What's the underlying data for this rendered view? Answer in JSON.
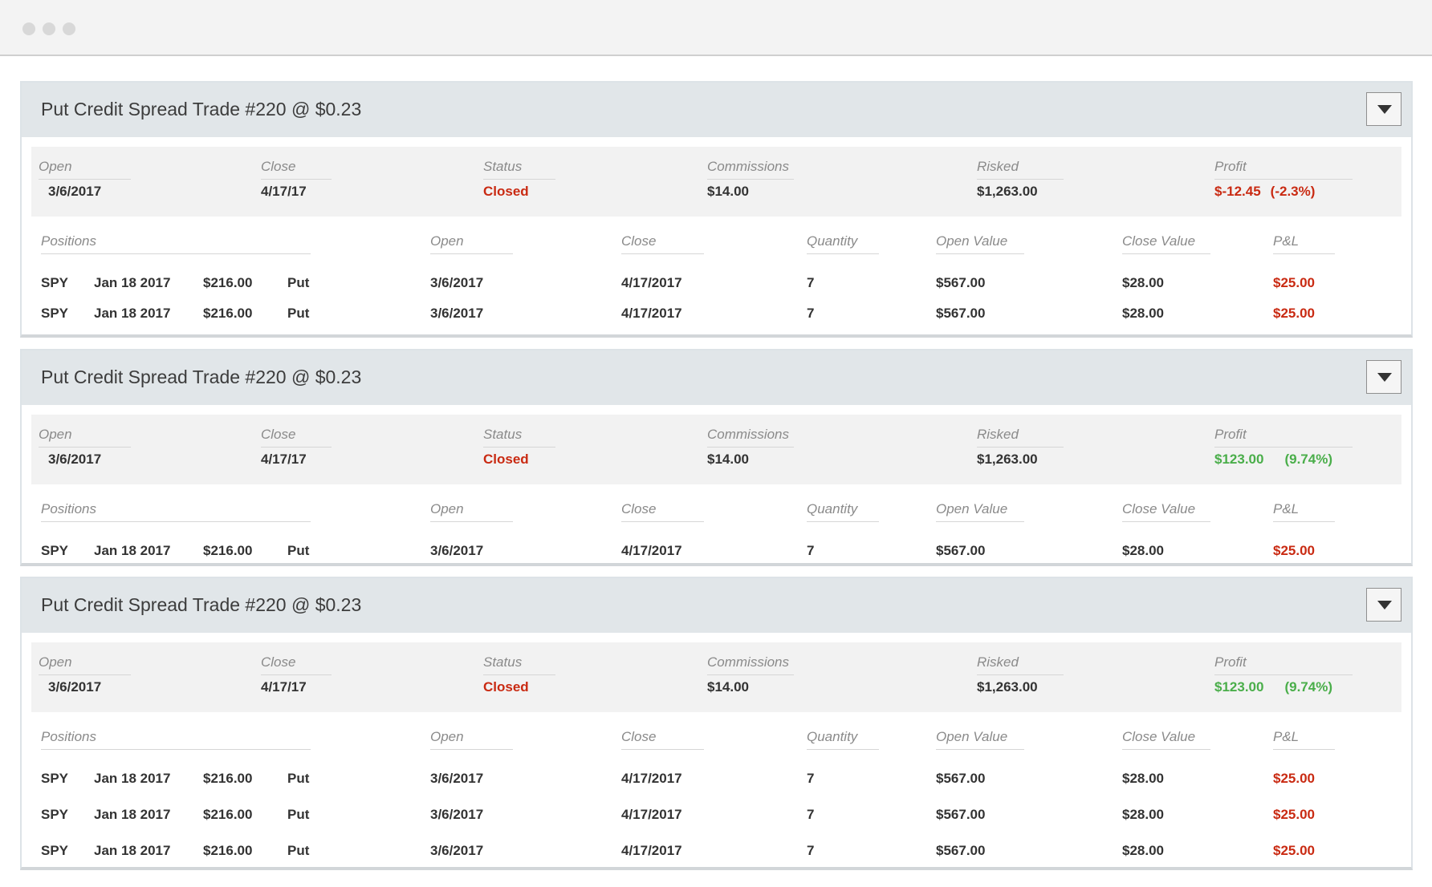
{
  "window": {
    "controls": [
      "window-dot-1",
      "window-dot-2",
      "window-dot-3"
    ]
  },
  "colors": {
    "loss": "#c92a12",
    "gain": "#4aae4a",
    "header_bg": "#e1e6e9",
    "summary_bg": "#f2f2f2"
  },
  "summary_labels": {
    "open": "Open",
    "close": "Close",
    "status": "Status",
    "commissions": "Commissions",
    "risked": "Risked",
    "profit": "Profit"
  },
  "position_labels": {
    "positions": "Positions",
    "open": "Open",
    "close": "Close",
    "quantity": "Quantity",
    "open_value": "Open Value",
    "close_value": "Close Value",
    "pnl": "P&L"
  },
  "trades": [
    {
      "title": "Put Credit Spread Trade #220 @ $0.23",
      "open": "3/6/2017",
      "close": "4/17/17",
      "status": "Closed",
      "commissions": "$14.00",
      "risked": "$1,263.00",
      "profit": "$-12.45",
      "profit_pct": "(-2.3%)",
      "profit_tone": "loss",
      "positions": [
        {
          "symbol": "SPY",
          "expiry": "Jan 18 2017",
          "strike": "$216.00",
          "type": "Put",
          "open": "3/6/2017",
          "close": "4/17/2017",
          "quantity": "7",
          "open_value": "$567.00",
          "close_value": "$28.00",
          "pnl": "$25.00"
        },
        {
          "symbol": "SPY",
          "expiry": "Jan 18 2017",
          "strike": "$216.00",
          "type": "Put",
          "open": "3/6/2017",
          "close": "4/17/2017",
          "quantity": "7",
          "open_value": "$567.00",
          "close_value": "$28.00",
          "pnl": "$25.00"
        }
      ]
    },
    {
      "title": "Put Credit Spread Trade #220 @ $0.23",
      "open": "3/6/2017",
      "close": "4/17/17",
      "status": "Closed",
      "commissions": "$14.00",
      "risked": "$1,263.00",
      "profit": "$123.00",
      "profit_pct": "(9.74%)",
      "profit_tone": "gain",
      "positions": [
        {
          "symbol": "SPY",
          "expiry": "Jan 18 2017",
          "strike": "$216.00",
          "type": "Put",
          "open": "3/6/2017",
          "close": "4/17/2017",
          "quantity": "7",
          "open_value": "$567.00",
          "close_value": "$28.00",
          "pnl": "$25.00"
        }
      ]
    },
    {
      "title": "Put Credit Spread Trade #220 @ $0.23",
      "open": "3/6/2017",
      "close": "4/17/17",
      "status": "Closed",
      "commissions": "$14.00",
      "risked": "$1,263.00",
      "profit": "$123.00",
      "profit_pct": "(9.74%)",
      "profit_tone": "gain",
      "positions": [
        {
          "symbol": "SPY",
          "expiry": "Jan 18 2017",
          "strike": "$216.00",
          "type": "Put",
          "open": "3/6/2017",
          "close": "4/17/2017",
          "quantity": "7",
          "open_value": "$567.00",
          "close_value": "$28.00",
          "pnl": "$25.00"
        },
        {
          "symbol": "SPY",
          "expiry": "Jan 18 2017",
          "strike": "$216.00",
          "type": "Put",
          "open": "3/6/2017",
          "close": "4/17/2017",
          "quantity": "7",
          "open_value": "$567.00",
          "close_value": "$28.00",
          "pnl": "$25.00"
        },
        {
          "symbol": "SPY",
          "expiry": "Jan 18 2017",
          "strike": "$216.00",
          "type": "Put",
          "open": "3/6/2017",
          "close": "4/17/2017",
          "quantity": "7",
          "open_value": "$567.00",
          "close_value": "$28.00",
          "pnl": "$25.00"
        }
      ]
    }
  ]
}
